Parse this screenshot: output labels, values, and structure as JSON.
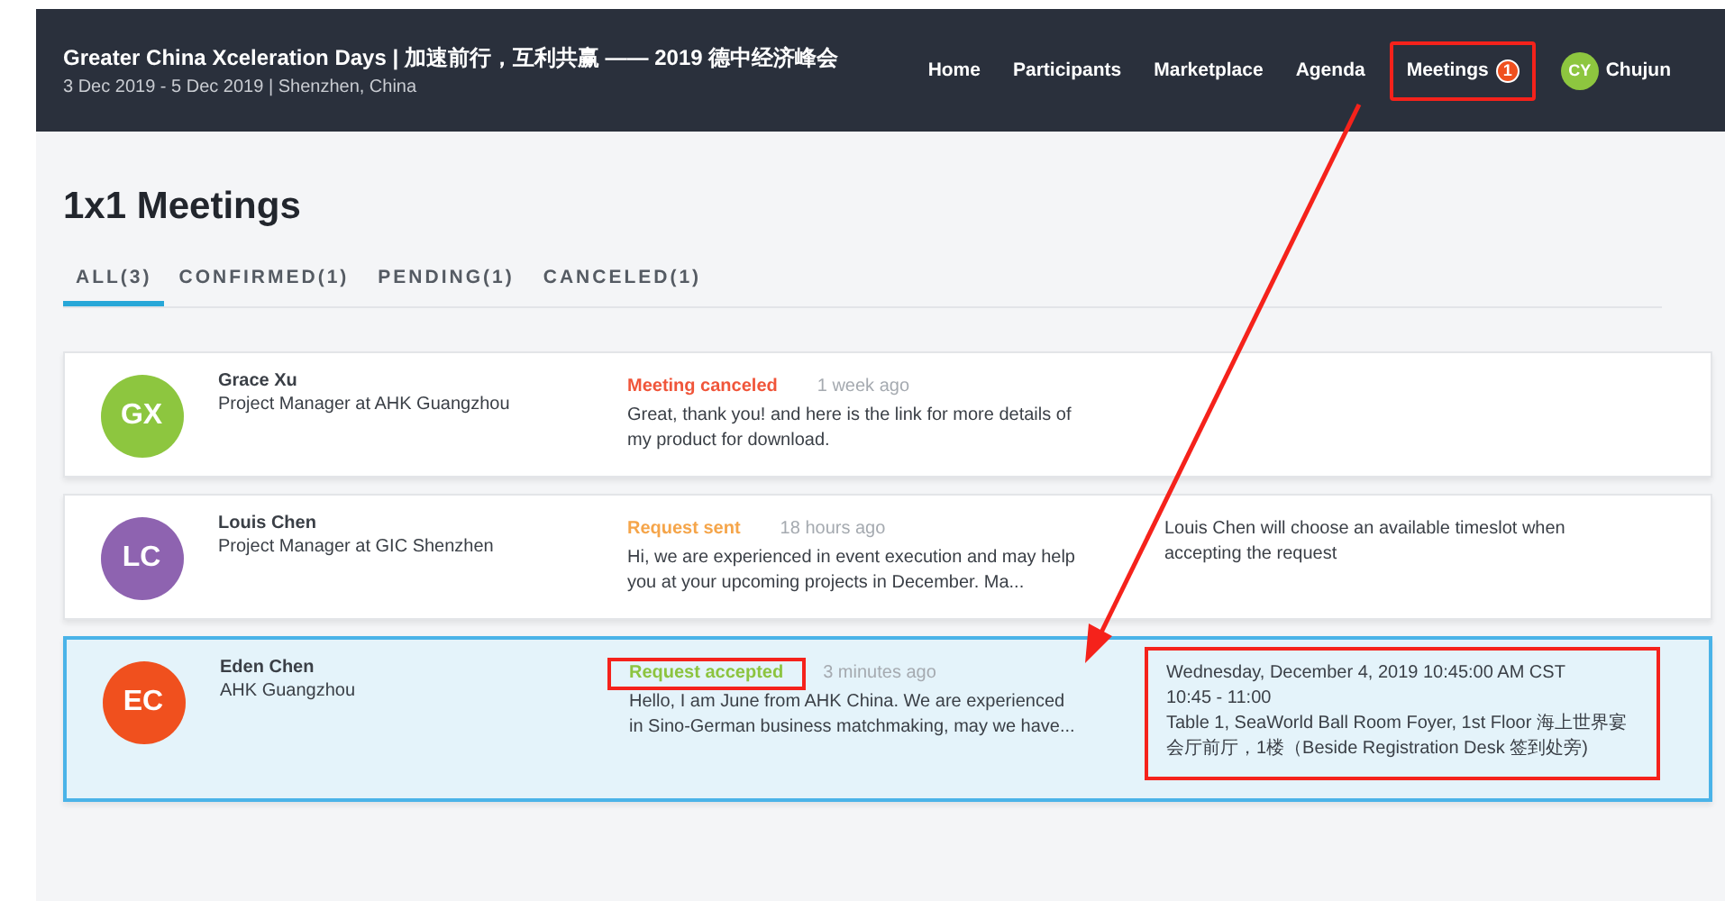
{
  "header": {
    "title": "Greater China Xceleration Days | 加速前行，互利共赢 —— 2019 德中经济峰会",
    "subtitle": "3 Dec 2019 - 5 Dec 2019 | Shenzhen, China",
    "nav": [
      {
        "label": "Home",
        "highlighted": false
      },
      {
        "label": "Participants",
        "highlighted": false
      },
      {
        "label": "Marketplace",
        "highlighted": false
      },
      {
        "label": "Agenda",
        "highlighted": false
      },
      {
        "label": "Meetings",
        "badge": "1",
        "highlighted": true
      }
    ],
    "user": {
      "initials": "CY",
      "name": "Chujun"
    }
  },
  "page_title": "1x1 Meetings",
  "tabs": [
    {
      "label": "ALL(3)",
      "selected": true
    },
    {
      "label": "CONFIRMED(1)",
      "selected": false
    },
    {
      "label": "PENDING(1)",
      "selected": false
    },
    {
      "label": "CANCELED(1)",
      "selected": false
    }
  ],
  "meetings": [
    {
      "initials": "GX",
      "color": "#8dc63f",
      "name": "Grace Xu",
      "role": "Project Manager at AHK Guangzhou",
      "status": {
        "kind": "canceled",
        "label": "Meeting canceled",
        "highlighted": false
      },
      "time": "1 week ago",
      "message": "Great, thank you! and here is the link for more details of my product for download.",
      "selected": false
    },
    {
      "initials": "LC",
      "color": "#8e63b0",
      "name": "Louis Chen",
      "role": "Project Manager at GIC Shenzhen",
      "status": {
        "kind": "sent",
        "label": "Request sent",
        "highlighted": false
      },
      "time": "18 hours ago",
      "message": "Hi, we are experienced in event execution and may help you at your upcoming projects in December. Ma...",
      "details": [
        "Louis Chen will choose an available timeslot when accepting the request"
      ],
      "details_highlighted": false,
      "selected": false
    },
    {
      "initials": "EC",
      "color": "#f0501e",
      "name": "Eden Chen",
      "role": "AHK Guangzhou",
      "status": {
        "kind": "accepted",
        "label": "Request accepted",
        "highlighted": true
      },
      "time": "3 minutes ago",
      "message": "Hello, I am June from AHK China. We are experienced in Sino-German business matchmaking, may we have...",
      "details": [
        "Wednesday, December 4, 2019 10:45:00 AM CST",
        "10:45 - 11:00",
        "Table 1, SeaWorld Ball Room Foyer, 1st Floor 海上世界宴会厅前厅，1楼（Beside Registration Desk 签到处旁)"
      ],
      "details_highlighted": true,
      "selected": true
    }
  ]
}
